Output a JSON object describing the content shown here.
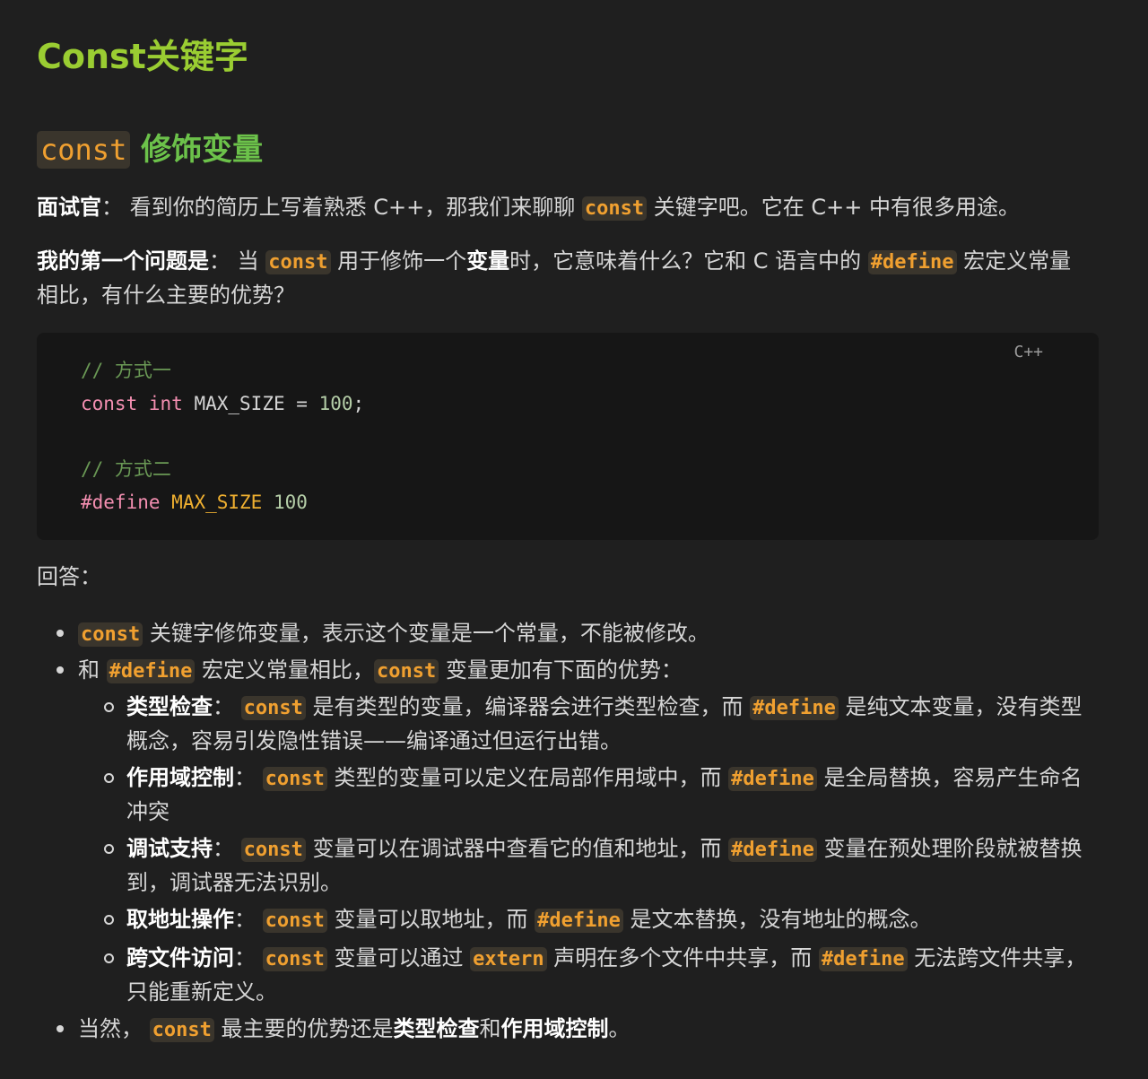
{
  "title": "Const关键字",
  "section": {
    "code": "const",
    "text": "修饰变量"
  },
  "interviewer": {
    "label": "面试官",
    "colon": "：",
    "t1": "看到你的简历上写着熟悉 C++，那我们来聊聊",
    "code": "const",
    "t2": "关键字吧。它在 C++ 中有很多用途。"
  },
  "question": {
    "label": "我的第一个问题是",
    "colon": "：",
    "t1": "当",
    "code1": "const",
    "t2": "用于修饰一个",
    "bold": "变量",
    "t3": "时，它意味着什么？它和 C 语言中的",
    "code2": "#define",
    "t4": "宏定义常量相比，有什么主要的优势？"
  },
  "code_block": {
    "language": "C++",
    "comment1": "// 方式一",
    "kw_const": "const",
    "kw_int": "int",
    "ident1": "MAX_SIZE",
    "op": "=",
    "num1": "100",
    "semi": ";",
    "comment2": "// 方式二",
    "directive": "#define",
    "macro": "MAX_SIZE",
    "num2": "100"
  },
  "answer_label": "回答：",
  "bullets": {
    "b1": {
      "code": "const",
      "text": "关键字修饰变量，表示这个变量是一个常量，不能被修改。"
    },
    "b2": {
      "t1": "和",
      "code1": "#define",
      "t2": "宏定义常量相比，",
      "code2": "const",
      "t3": "变量更加有下面的优势："
    },
    "sub": {
      "s1": {
        "label": "类型检查",
        "colon": "：",
        "code1": "const",
        "t1": "是有类型的变量，编译器会进行类型检查，而",
        "code2": "#define",
        "t2": "是纯文本变量，没有类型概念，容易引发隐性错误——编译通过但运行出错。"
      },
      "s2": {
        "label": "作用域控制",
        "colon": "：",
        "code1": "const",
        "t1": "类型的变量可以定义在局部作用域中，而",
        "code2": "#define",
        "t2": "是全局替换，容易产生命名冲突"
      },
      "s3": {
        "label": "调试支持",
        "colon": "：",
        "code1": "const",
        "t1": "变量可以在调试器中查看它的值和地址，而",
        "code2": "#define",
        "t2": "变量在预处理阶段就被替换到，调试器无法识别。"
      },
      "s4": {
        "label": "取地址操作",
        "colon": "：",
        "code1": "const",
        "t1": "变量可以取地址，而",
        "code2": "#define",
        "t2": "是文本替换，没有地址的概念。"
      },
      "s5": {
        "label": "跨文件访问",
        "colon": "：",
        "code1": "const",
        "t1": "变量可以通过",
        "code2": "extern",
        "t2": "声明在多个文件中共享，而",
        "code3": "#define",
        "t3": "无法跨文件共享，只能重新定义。"
      }
    },
    "b3": {
      "t1": "当然，",
      "code": "const",
      "t2": "最主要的优势还是",
      "bold1": "类型检查",
      "t3": "和",
      "bold2": "作用域控制",
      "t4": "。"
    }
  },
  "colors": {
    "title": "#9acd32",
    "heading": "#6cc24a",
    "inline_code": "#f0a030",
    "background": "#1f1f1f"
  }
}
